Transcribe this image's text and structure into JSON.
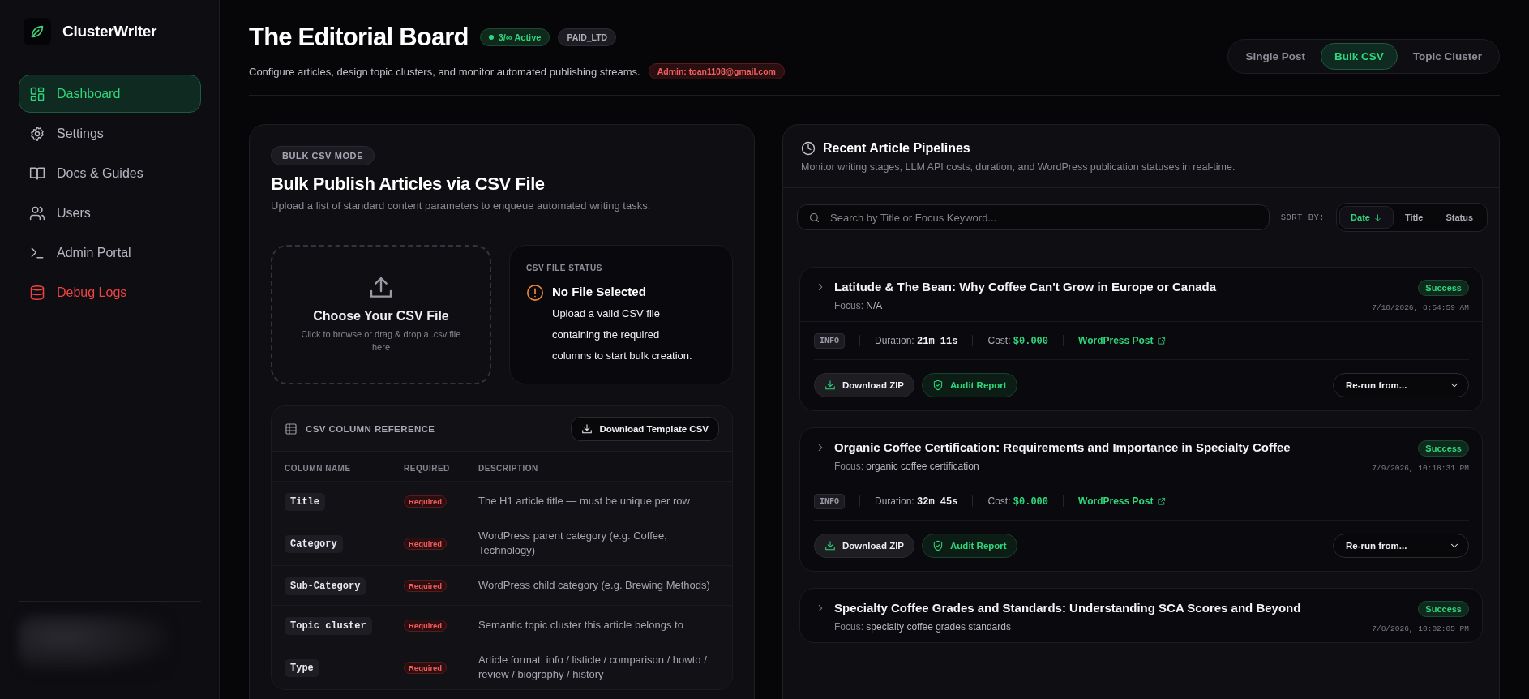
{
  "sidebar": {
    "brand": "ClusterWriter",
    "items": [
      {
        "label": "Dashboard",
        "kind": "grid",
        "selected": true,
        "danger": false
      },
      {
        "label": "Settings",
        "kind": "gear",
        "selected": false,
        "danger": false
      },
      {
        "label": "Docs & Guides",
        "kind": "book",
        "selected": false,
        "danger": false
      },
      {
        "label": "Users",
        "kind": "users",
        "selected": false,
        "danger": false
      },
      {
        "label": "Admin Portal",
        "kind": "terminal",
        "selected": false,
        "danger": false
      },
      {
        "label": "Debug Logs",
        "kind": "database",
        "selected": false,
        "danger": true
      }
    ]
  },
  "header": {
    "title": "The Editorial Board",
    "badges": [
      {
        "label": "3/∞ Active",
        "kind": "status"
      },
      {
        "label": "PAID_LTD",
        "kind": "plan"
      }
    ],
    "subtitle": "Configure articles, design topic clusters, and monitor automated publishing streams.",
    "admin": "Admin: toan1108@gmail.com",
    "mode_tabs": [
      {
        "label": "Single Post",
        "selected": false
      },
      {
        "label": "Bulk CSV",
        "selected": true
      },
      {
        "label": "Topic Cluster",
        "selected": false
      }
    ]
  },
  "bulk_panel": {
    "mode_badge": "BULK CSV MODE",
    "title": "Bulk Publish Articles via CSV File",
    "subtitle": "Upload a list of standard content parameters to enqueue automated writing tasks.",
    "dropzone": {
      "title": "Choose Your CSV File",
      "hint": "Click to browse or drag & drop a .csv file here"
    },
    "file_status": {
      "label": "CSV FILE STATUS",
      "title": "No File Selected",
      "message": "Upload a valid CSV file containing the required columns to start bulk creation."
    },
    "reference": {
      "title": "CSV COLUMN REFERENCE",
      "download_button": "Download Template CSV",
      "columns": [
        "COLUMN NAME",
        "REQUIRED",
        "DESCRIPTION"
      ],
      "rows": [
        {
          "name": "Title",
          "required": "Required",
          "description": "The H1 article title — must be unique per row"
        },
        {
          "name": "Category",
          "required": "Required",
          "description": "WordPress parent category (e.g. Coffee, Technology)"
        },
        {
          "name": "Sub-Category",
          "required": "Required",
          "description": "WordPress child category (e.g. Brewing Methods)"
        },
        {
          "name": "Topic cluster",
          "required": "Required",
          "description": "Semantic topic cluster this article belongs to"
        },
        {
          "name": "Type",
          "required": "Required",
          "description": "Article format: info / listicle / comparison / howto / review / biography / history"
        }
      ]
    }
  },
  "pipelines_panel": {
    "title": "Recent Article Pipelines",
    "subtitle": "Monitor writing stages, LLM API costs, duration, and WordPress publication statuses in real-time.",
    "search": {
      "placeholder": "Search by Title or Focus Keyword..."
    },
    "sort_label": "SORT BY:",
    "sort_options": [
      {
        "label": "Date",
        "selected": true
      },
      {
        "label": "Title",
        "selected": false
      },
      {
        "label": "Status",
        "selected": false
      }
    ],
    "pipelines": [
      {
        "title": "Latitude & The Bean: Why Coffee Can't Grow in Europe or Canada",
        "focus_label": "Focus:",
        "focus": "N/A",
        "status": "Success",
        "timestamp": "7/10/2026, 8:54:59 AM",
        "expanded": false,
        "details": {
          "level": "INFO",
          "duration_label": "Duration:",
          "duration": "21m 11s",
          "cost_label": "Cost:",
          "cost": "$0.000",
          "link": "WordPress Post",
          "download": "Download ZIP",
          "audit": "Audit Report",
          "rerun": "Re-run from..."
        }
      },
      {
        "title": "Organic Coffee Certification: Requirements and Importance in Specialty Coffee",
        "focus_label": "Focus:",
        "focus": "organic coffee certification",
        "status": "Success",
        "timestamp": "7/9/2026, 10:18:31 PM",
        "expanded": false,
        "details": {
          "level": "INFO",
          "duration_label": "Duration:",
          "duration": "32m 45s",
          "cost_label": "Cost:",
          "cost": "$0.000",
          "link": "WordPress Post",
          "download": "Download ZIP",
          "audit": "Audit Report",
          "rerun": "Re-run from..."
        }
      },
      {
        "title": "Specialty Coffee Grades and Standards: Understanding SCA Scores and Beyond",
        "focus_label": "Focus:",
        "focus": "specialty coffee grades standards",
        "status": "Success",
        "timestamp": "7/8/2026, 10:02:05 PM",
        "expanded": false
      }
    ]
  }
}
